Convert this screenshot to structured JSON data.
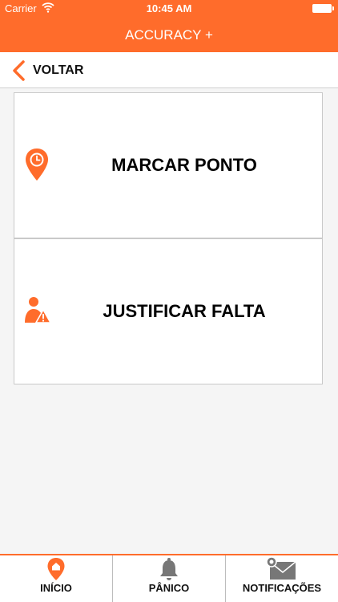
{
  "status_bar": {
    "carrier": "Carrier",
    "time": "10:45 AM"
  },
  "app_title": "ACCURACY +",
  "back_label": "VOLTAR",
  "cards": [
    {
      "label": "MARCAR PONTO",
      "icon": "clock-location-icon"
    },
    {
      "label": "JUSTIFICAR FALTA",
      "icon": "user-warning-icon"
    }
  ],
  "tabs": [
    {
      "label": "INÍCIO",
      "icon": "home-pin-icon",
      "active": true
    },
    {
      "label": "PÂNICO",
      "icon": "bell-icon"
    },
    {
      "label": "NOTIFICAÇÕES",
      "icon": "mail-notification-icon"
    }
  ],
  "colors": {
    "accent": "#ff6c2b",
    "icon_gray": "#777777"
  }
}
